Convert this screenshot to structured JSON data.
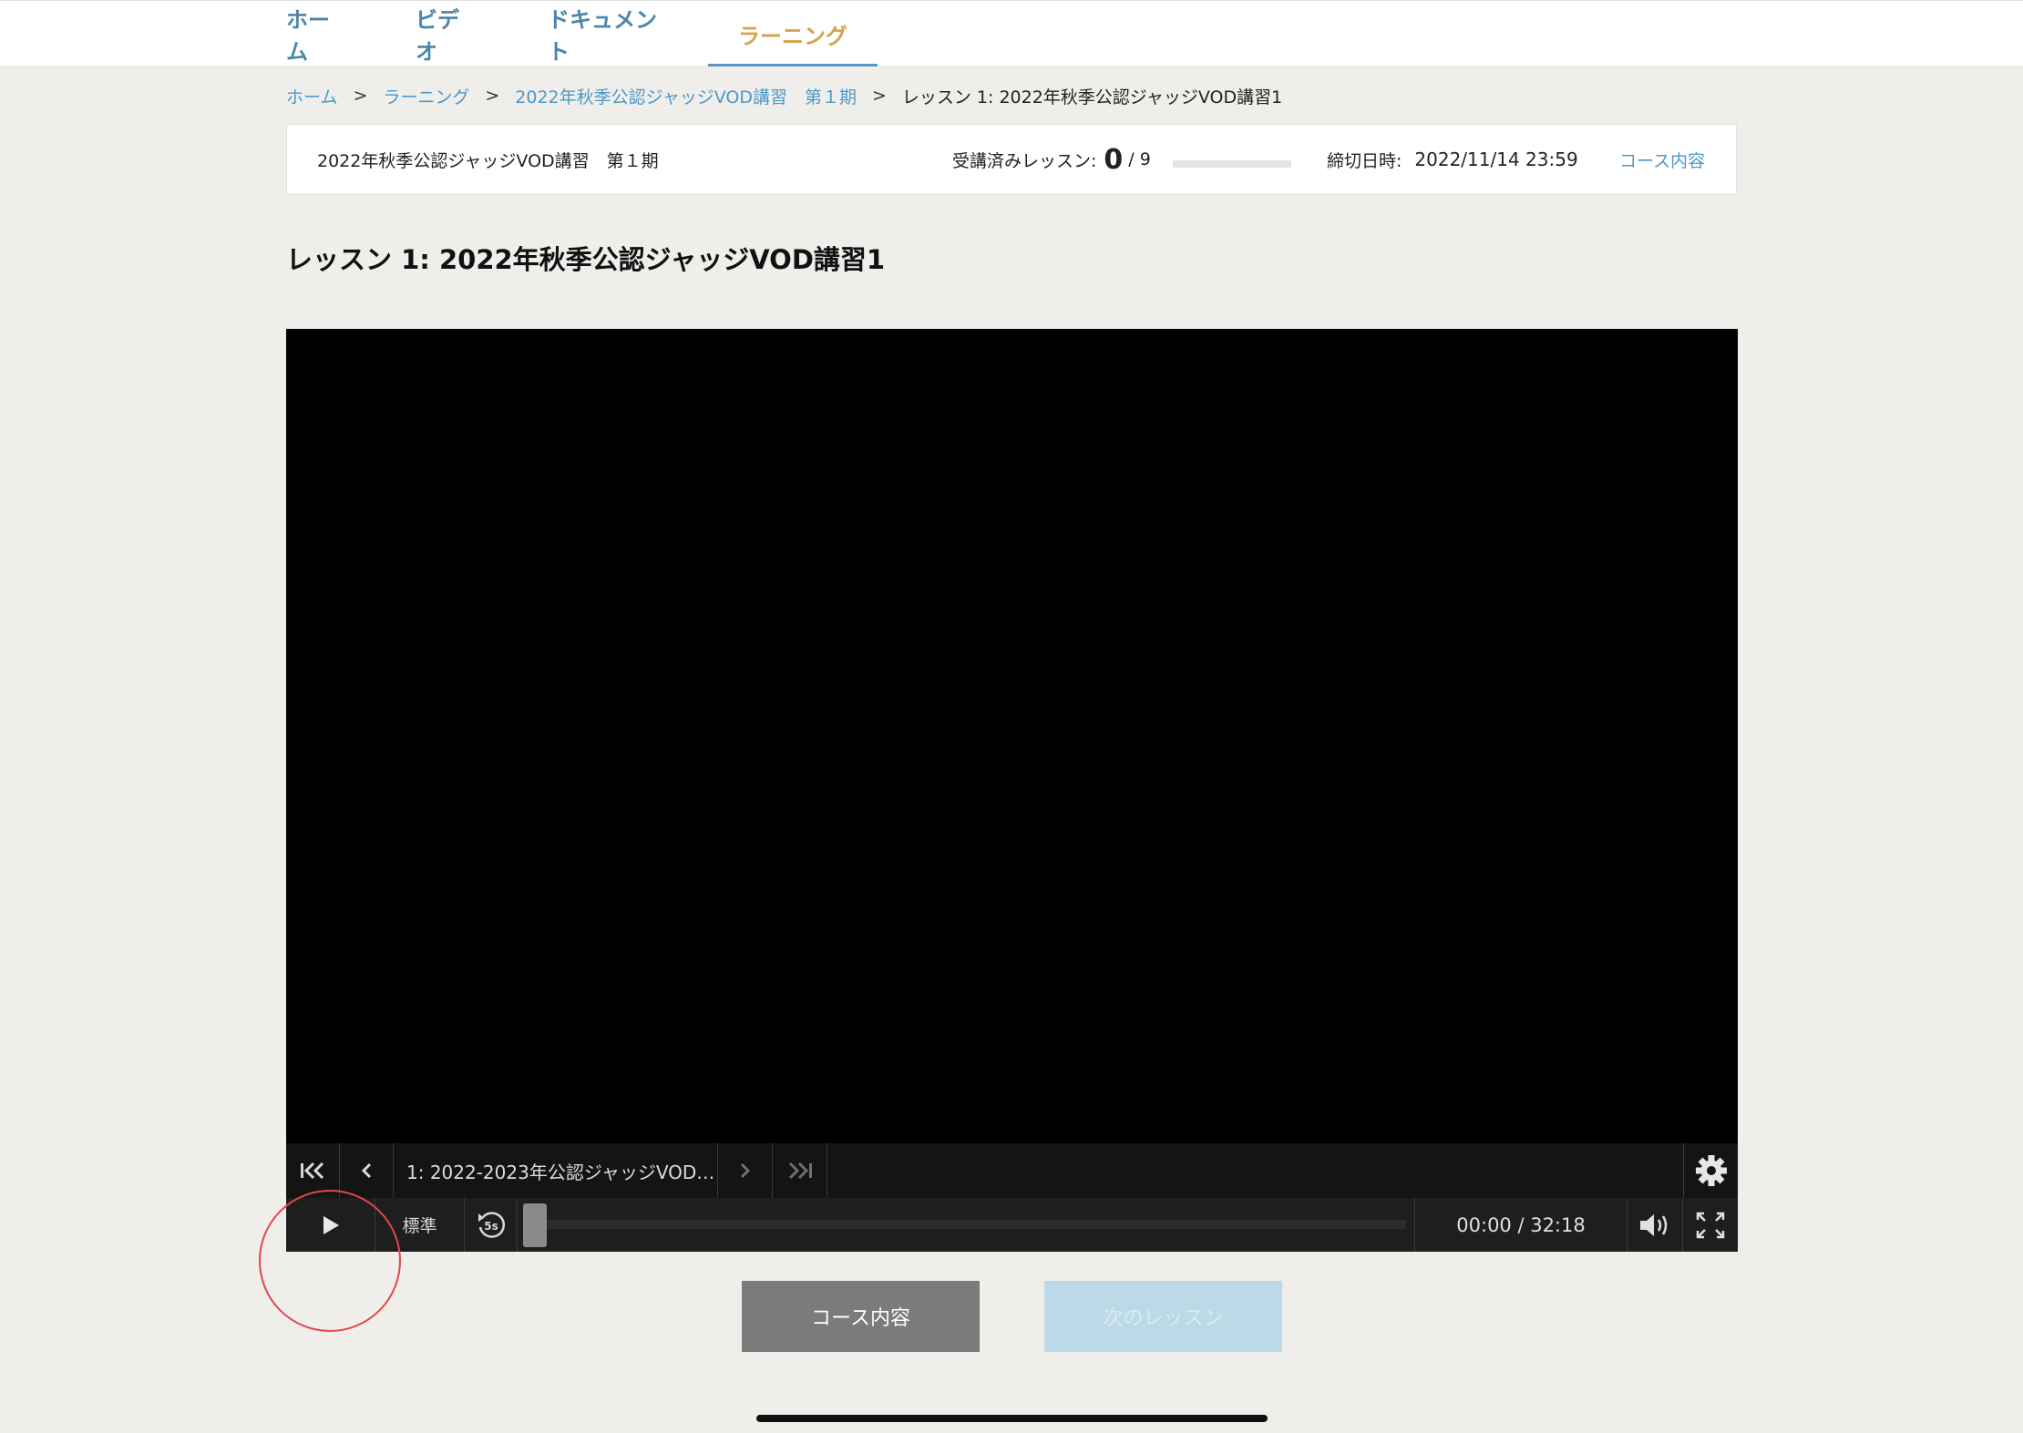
{
  "nav": {
    "tabs": [
      {
        "label": "ホーム"
      },
      {
        "label": "ビデオ"
      },
      {
        "label": "ドキュメント"
      },
      {
        "label": "ラーニング",
        "active": true
      }
    ]
  },
  "breadcrumb": {
    "items": [
      "ホーム",
      "ラーニング",
      "2022年秋季公認ジャッジVOD講習　第１期"
    ],
    "separator": ">",
    "current": "レッスン 1: 2022年秋季公認ジャッジVOD講習1"
  },
  "course_bar": {
    "course_name": "2022年秋季公認ジャッジVOD講習　第１期",
    "completed_label": "受講済みレッスン:",
    "completed_count": "0",
    "total_lessons": "/ 9",
    "progress": 0,
    "deadline_label": "締切日時:",
    "deadline_value": "2022/11/14 23:59",
    "course_contents_link": "コース内容"
  },
  "lesson_title": "レッスン 1: 2022年秋季公認ジャッジVOD講習1",
  "player": {
    "playlist_item": "1: 2022-2023年公認ジャッジVOD…",
    "speed": "標準",
    "skip_back_label": "5s",
    "time": "00:00 / 32:18",
    "seek_position": 0
  },
  "actions": {
    "course_contents": "コース内容",
    "next_lesson": "次のレッスン"
  },
  "colors": {
    "link": "#4d98c9",
    "active_tab": "#d4a24a",
    "highlight": "#e0474c"
  }
}
